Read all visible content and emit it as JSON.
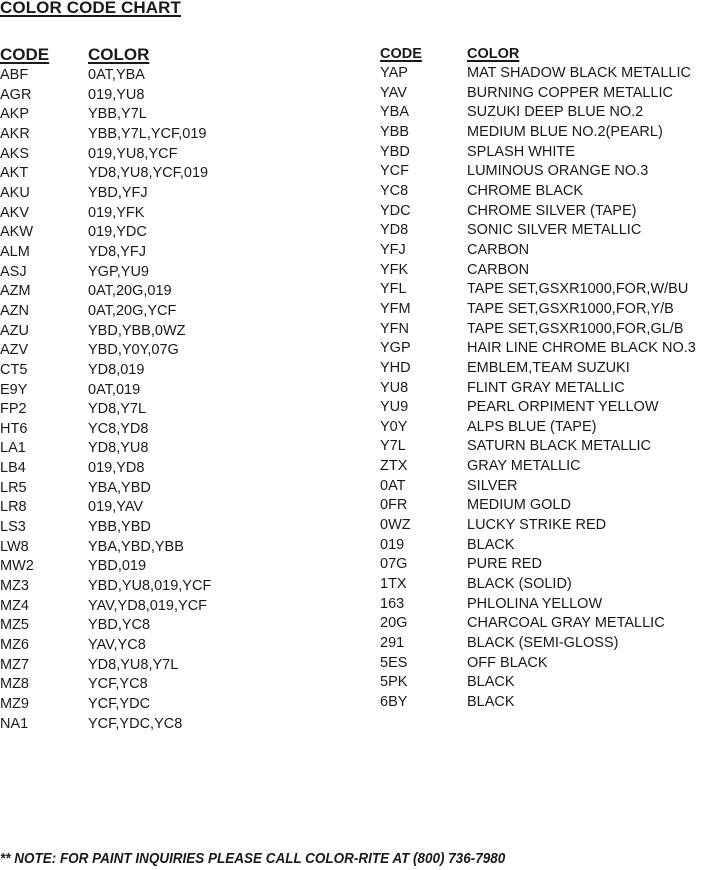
{
  "title": "COLOR CODE CHART",
  "headers": {
    "code": "CODE",
    "color": "COLOR"
  },
  "left_table": [
    {
      "code": "ABF",
      "color": "0AT,YBA"
    },
    {
      "code": "AGR",
      "color": "019,YU8"
    },
    {
      "code": "AKP",
      "color": "YBB,Y7L"
    },
    {
      "code": "AKR",
      "color": "YBB,Y7L,YCF,019"
    },
    {
      "code": "AKS",
      "color": "019,YU8,YCF"
    },
    {
      "code": "AKT",
      "color": "YD8,YU8,YCF,019"
    },
    {
      "code": "AKU",
      "color": "YBD,YFJ"
    },
    {
      "code": "AKV",
      "color": "019,YFK"
    },
    {
      "code": "AKW",
      "color": "019,YDC"
    },
    {
      "code": "ALM",
      "color": "YD8,YFJ"
    },
    {
      "code": "ASJ",
      "color": "YGP,YU9"
    },
    {
      "code": "AZM",
      "color": "0AT,20G,019"
    },
    {
      "code": "AZN",
      "color": "0AT,20G,YCF"
    },
    {
      "code": "AZU",
      "color": "YBD,YBB,0WZ"
    },
    {
      "code": "AZV",
      "color": "YBD,Y0Y,07G"
    },
    {
      "code": "CT5",
      "color": "YD8,019"
    },
    {
      "code": "E9Y",
      "color": "0AT,019"
    },
    {
      "code": "FP2",
      "color": "YD8,Y7L"
    },
    {
      "code": "HT6",
      "color": "YC8,YD8"
    },
    {
      "code": "LA1",
      "color": "YD8,YU8"
    },
    {
      "code": "LB4",
      "color": "019,YD8"
    },
    {
      "code": "LR5",
      "color": "YBA,YBD"
    },
    {
      "code": "LR8",
      "color": "019,YAV"
    },
    {
      "code": "LS3",
      "color": "YBB,YBD"
    },
    {
      "code": "LW8",
      "color": "YBA,YBD,YBB"
    },
    {
      "code": "MW2",
      "color": "YBD,019"
    },
    {
      "code": "MZ3",
      "color": "YBD,YU8,019,YCF"
    },
    {
      "code": "MZ4",
      "color": "YAV,YD8,019,YCF"
    },
    {
      "code": "MZ5",
      "color": "YBD,YC8"
    },
    {
      "code": "MZ6",
      "color": "YAV,YC8"
    },
    {
      "code": "MZ7",
      "color": "YD8,YU8,Y7L"
    },
    {
      "code": "MZ8",
      "color": "YCF,YC8"
    },
    {
      "code": "MZ9",
      "color": "YCF,YDC"
    },
    {
      "code": "NA1",
      "color": "YCF,YDC,YC8"
    }
  ],
  "right_table": [
    {
      "code": "YAP",
      "color": "MAT SHADOW BLACK METALLIC"
    },
    {
      "code": "YAV",
      "color": "BURNING COPPER METALLIC"
    },
    {
      "code": "YBA",
      "color": "SUZUKI DEEP BLUE NO.2"
    },
    {
      "code": "YBB",
      "color": "MEDIUM BLUE NO.2(PEARL)"
    },
    {
      "code": "YBD",
      "color": "SPLASH WHITE"
    },
    {
      "code": "YCF",
      "color": "LUMINOUS ORANGE NO.3"
    },
    {
      "code": "YC8",
      "color": "CHROME BLACK"
    },
    {
      "code": "YDC",
      "color": "CHROME SILVER (TAPE)"
    },
    {
      "code": "YD8",
      "color": "SONIC SILVER METALLIC"
    },
    {
      "code": "YFJ",
      "color": "CARBON"
    },
    {
      "code": "YFK",
      "color": "CARBON"
    },
    {
      "code": "YFL",
      "color": "TAPE SET,GSXR1000,FOR,W/BU"
    },
    {
      "code": "YFM",
      "color": "TAPE SET,GSXR1000,FOR,Y/B"
    },
    {
      "code": "YFN",
      "color": "TAPE SET,GSXR1000,FOR,GL/B"
    },
    {
      "code": "YGP",
      "color": "HAIR LINE CHROME BLACK NO.3"
    },
    {
      "code": "YHD",
      "color": "EMBLEM,TEAM SUZUKI"
    },
    {
      "code": "YU8",
      "color": "FLINT GRAY METALLIC"
    },
    {
      "code": "YU9",
      "color": "PEARL ORPIMENT YELLOW"
    },
    {
      "code": "Y0Y",
      "color": "ALPS BLUE (TAPE)"
    },
    {
      "code": "Y7L",
      "color": "SATURN BLACK METALLIC"
    },
    {
      "code": "ZTX",
      "color": "GRAY METALLIC"
    },
    {
      "code": "0AT",
      "color": "SILVER"
    },
    {
      "code": "0FR",
      "color": "MEDIUM GOLD"
    },
    {
      "code": "0WZ",
      "color": "LUCKY STRIKE RED"
    },
    {
      "code": "019",
      "color": "BLACK"
    },
    {
      "code": "07G",
      "color": "PURE RED"
    },
    {
      "code": "1TX",
      "color": "BLACK (SOLID)"
    },
    {
      "code": "163",
      "color": "PHLOLINA YELLOW"
    },
    {
      "code": "20G",
      "color": "CHARCOAL GRAY METALLIC"
    },
    {
      "code": "291",
      "color": "BLACK (SEMI-GLOSS)"
    },
    {
      "code": "5ES",
      "color": "OFF BLACK"
    },
    {
      "code": "5PK",
      "color": "BLACK"
    },
    {
      "code": "6BY",
      "color": "BLACK"
    }
  ],
  "note": "** NOTE: FOR PAINT INQUIRIES PLEASE CALL COLOR-RITE AT (800) 736-7980"
}
